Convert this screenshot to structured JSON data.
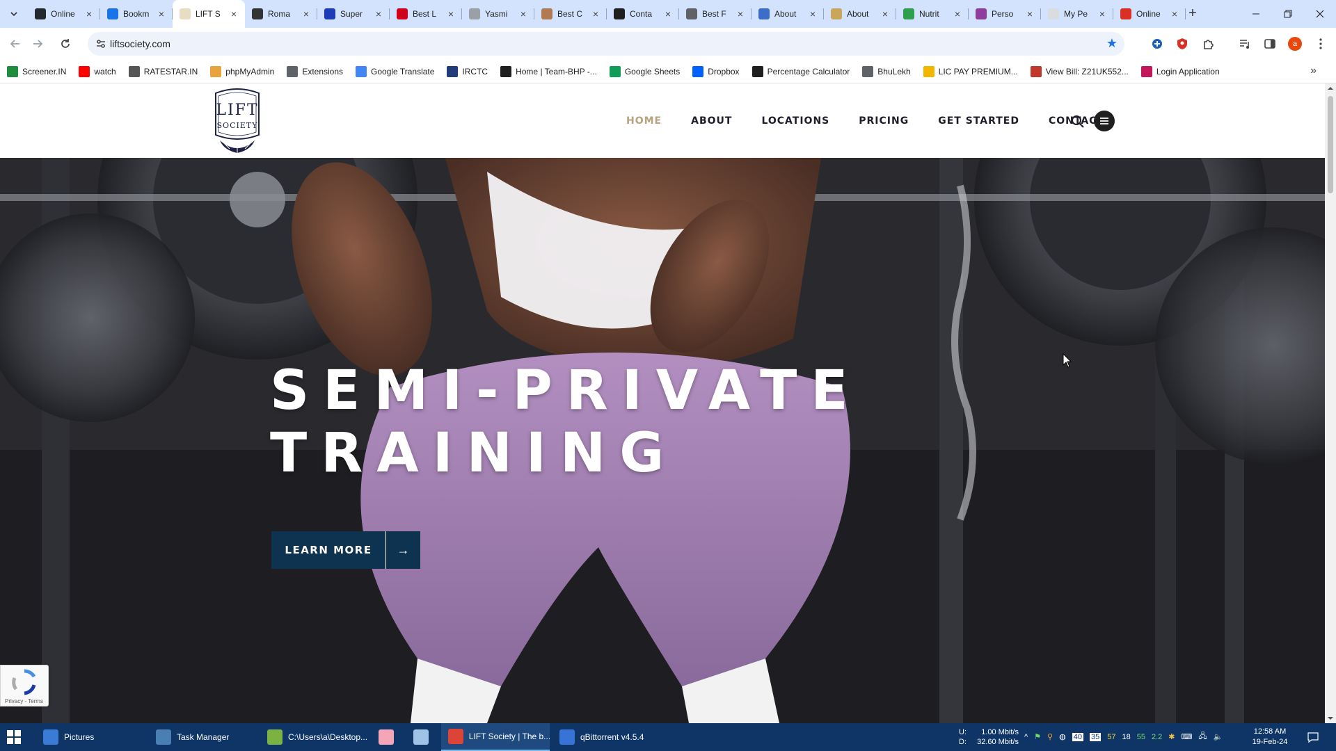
{
  "browser": {
    "tabs": [
      {
        "title": "Online",
        "favicon": "github-icon",
        "color": "#24292f",
        "active": false
      },
      {
        "title": "Bookm",
        "favicon": "star-icon",
        "color": "#1a73e8",
        "active": false
      },
      {
        "title": "LIFT S",
        "favicon": "lift-society-icon",
        "color": "#e8dcc2",
        "active": true
      },
      {
        "title": "Roma",
        "favicon": "ws-icon",
        "color": "#333333",
        "active": false
      },
      {
        "title": "Super",
        "favicon": "circle-icon",
        "color": "#1e3bb8",
        "active": false
      },
      {
        "title": "Best L",
        "favicon": "red-square-icon",
        "color": "#d0021b",
        "active": false
      },
      {
        "title": "Yasmi",
        "favicon": "image-icon",
        "color": "#9aa0a6",
        "active": false
      },
      {
        "title": "Best C",
        "favicon": "food-icon",
        "color": "#b07a52",
        "active": false
      },
      {
        "title": "Conta",
        "favicon": "frame-icon",
        "color": "#1f1f1f",
        "active": false
      },
      {
        "title": "Best F",
        "favicon": "clock-icon",
        "color": "#5f6368",
        "active": false
      },
      {
        "title": "About",
        "favicon": "about-icon",
        "color": "#3c6ec9",
        "active": false
      },
      {
        "title": "About",
        "favicon": "leaf-icon",
        "color": "#c8a75a",
        "active": false
      },
      {
        "title": "Nutrit",
        "favicon": "nutrition-icon",
        "color": "#2e9e4f",
        "active": false
      },
      {
        "title": "Perso",
        "favicon": "person-icon",
        "color": "#8e3d9c",
        "active": false
      },
      {
        "title": "My Pe",
        "favicon": "page-icon",
        "color": "#dadce0",
        "active": false
      },
      {
        "title": "Online",
        "favicon": "red-circle-icon",
        "color": "#d93025",
        "active": false
      }
    ],
    "url": "liftsociety.com",
    "profile_initial": "a",
    "bookmarks": [
      {
        "label": "Screener.IN",
        "icon": "chart-icon",
        "color": "#1e8e3e"
      },
      {
        "label": "watch",
        "icon": "youtube-icon",
        "color": "#ff0000"
      },
      {
        "label": "RATESTAR.IN",
        "icon": "ratestar-icon",
        "color": "#555555"
      },
      {
        "label": "phpMyAdmin",
        "icon": "phpmyadmin-icon",
        "color": "#e8a33c"
      },
      {
        "label": "Extensions",
        "icon": "puzzle-icon",
        "color": "#5f6368"
      },
      {
        "label": "Google Translate",
        "icon": "translate-icon",
        "color": "#4285f4"
      },
      {
        "label": "IRCTC",
        "icon": "irctc-icon",
        "color": "#213d77"
      },
      {
        "label": "Home | Team-BHP -...",
        "icon": "teambhp-icon",
        "color": "#1f1f1f"
      },
      {
        "label": "Google Sheets",
        "icon": "sheets-icon",
        "color": "#0f9d58"
      },
      {
        "label": "Dropbox",
        "icon": "dropbox-icon",
        "color": "#0061fe"
      },
      {
        "label": "Percentage Calculator",
        "icon": "percent-icon",
        "color": "#1f1f1f"
      },
      {
        "label": "BhuLekh",
        "icon": "globe-icon",
        "color": "#5f6368"
      },
      {
        "label": "LIC PAY PREMIUM...",
        "icon": "lic-icon",
        "color": "#f2b600"
      },
      {
        "label": "View Bill: Z21UK552...",
        "icon": "bill-icon",
        "color": "#c0392b"
      },
      {
        "label": "Login Application",
        "icon": "login-icon",
        "color": "#c2185b"
      }
    ]
  },
  "site": {
    "logo_text_top": "LIFT",
    "logo_text_bottom": "SOCIETY",
    "nav": [
      {
        "label": "HOME",
        "active": true
      },
      {
        "label": "ABOUT",
        "active": false
      },
      {
        "label": "LOCATIONS",
        "active": false
      },
      {
        "label": "PRICING",
        "active": false
      },
      {
        "label": "GET STARTED",
        "active": false
      },
      {
        "label": "CONTACT",
        "active": false
      }
    ],
    "hero": {
      "title_line1": "SEMI-PRIVATE",
      "title_line2": "TRAINING",
      "cta_label": "LEARN MORE",
      "cta_arrow": "→"
    },
    "recaptcha_terms": "Privacy - Terms"
  },
  "taskbar": {
    "apps": [
      {
        "label": "Pictures",
        "icon": "folder-icon",
        "color": "#3a7bd5"
      },
      {
        "label": "Task Manager",
        "icon": "task-manager-icon",
        "color": "#4a7fb3"
      },
      {
        "label": "C:\\Users\\a\\Desktop...",
        "icon": "notepad-plus-icon",
        "color": "#7bb241"
      },
      {
        "label": "",
        "icon": "pig-icon",
        "color": "#f4a6b8"
      },
      {
        "label": "",
        "icon": "notepad-icon",
        "color": "#9ec3e6"
      },
      {
        "label": "LIFT Society | The b...",
        "icon": "chrome-icon",
        "color": "#db4437"
      },
      {
        "label": "qBittorrent v4.5.4",
        "icon": "qbittorrent-icon",
        "color": "#3874d6"
      }
    ],
    "upload_label": "U:",
    "download_label": "D:",
    "upload_speed": "1.00 Mbit/s",
    "download_speed": "32.60 Mbit/s",
    "tray_numbers": [
      "57",
      "18",
      "55",
      "2.2"
    ],
    "time": "12:58 AM",
    "date": "19-Feb-24"
  }
}
